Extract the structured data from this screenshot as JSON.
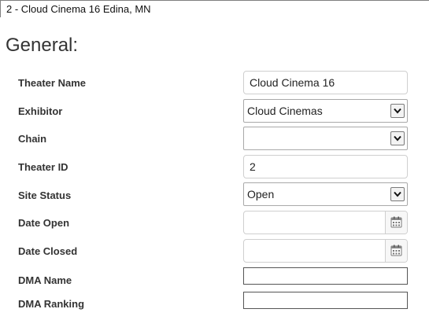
{
  "header": {
    "title": "2 - Cloud Cinema 16 Edina, MN"
  },
  "section": {
    "title": "General:"
  },
  "form": {
    "theater_name": {
      "label": "Theater Name",
      "value": "Cloud Cinema 16"
    },
    "exhibitor": {
      "label": "Exhibitor",
      "value": "Cloud Cinemas"
    },
    "chain": {
      "label": "Chain",
      "value": ""
    },
    "theater_id": {
      "label": "Theater ID",
      "value": "2"
    },
    "site_status": {
      "label": "Site Status",
      "value": "Open"
    },
    "date_open": {
      "label": "Date Open",
      "value": ""
    },
    "date_closed": {
      "label": "Date Closed",
      "value": ""
    },
    "dma_name": {
      "label": "DMA Name",
      "value": ""
    },
    "dma_ranking": {
      "label": "DMA Ranking",
      "value": ""
    }
  },
  "icons": {
    "dropdown": "chevron-down-icon",
    "date_picker": "calendar-icon"
  }
}
